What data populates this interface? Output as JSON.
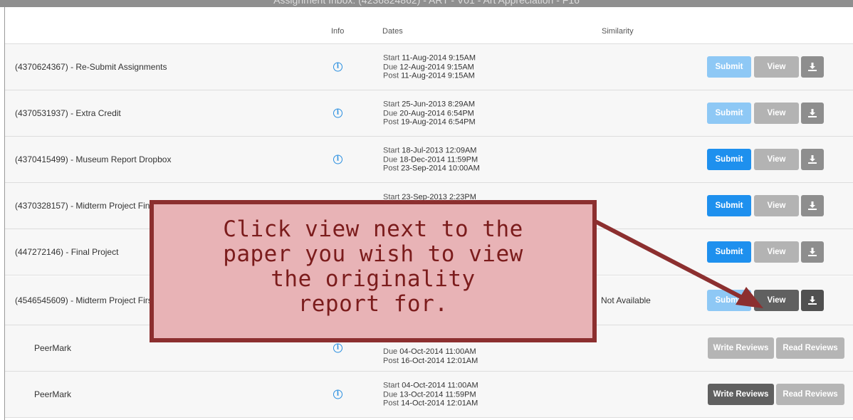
{
  "top_title": "Assignment Inbox: (4236824862) - ART - V01 - Art Appreciation - F16",
  "headers": {
    "info": "Info",
    "dates": "Dates",
    "similarity": "Similarity"
  },
  "labels": {
    "start": "Start",
    "due": "Due",
    "post": "Post",
    "submit": "Submit",
    "view": "View",
    "write_reviews": "Write Reviews",
    "read_reviews": "Read Reviews"
  },
  "assignments": [
    {
      "title": "(4370624367) - Re-Submit Assignments",
      "start": "11-Aug-2014  9:15AM",
      "due": "12-Aug-2014  9:15AM",
      "post": "11-Aug-2014  9:15AM",
      "similarity": ""
    },
    {
      "title": "(4370531937) - Extra Credit",
      "start": "25-Jun-2013  8:29AM",
      "due": "20-Aug-2014  6:54PM",
      "post": "19-Aug-2014  6:54PM",
      "similarity": ""
    },
    {
      "title": "(4370415499) - Museum Report Dropbox",
      "start": "18-Jul-2013  12:09AM",
      "due": "18-Dec-2014  11:59PM",
      "post": "23-Sep-2014  10:00AM",
      "similarity": ""
    },
    {
      "title": "(4370328157) - Midterm Project Fin",
      "start": "23-Sep-2013  2:23PM",
      "due": "",
      "post": "",
      "similarity": ""
    },
    {
      "title": "(447272146) - Final Project",
      "start": "",
      "due": "",
      "post": "",
      "similarity": ""
    },
    {
      "title": "(4546545609) - Midterm Project Firs",
      "start": "",
      "due": "",
      "post": "",
      "similarity": "Not Available"
    },
    {
      "title": "PeerMark",
      "start": "",
      "due": "04-Oct-2014  11:00AM",
      "post": "16-Oct-2014  12:01AM",
      "similarity": ""
    },
    {
      "title": "PeerMark",
      "start": "04-Oct-2014  11:00AM",
      "due": "13-Oct-2014  11:59PM",
      "post": "14-Oct-2014  12:01AM",
      "similarity": ""
    }
  ],
  "callout": {
    "line1": "Click view next to the",
    "line2": "paper you wish to view",
    "line3": "the originality",
    "line4": "report for."
  },
  "colors": {
    "submit_active": "#1e90ee",
    "submit_disabled": "#8ec8f5",
    "view_active": "#606060",
    "view_disabled": "#b3b3b3",
    "callout_fill": "#e8b3b6",
    "callout_border": "#8c2f2f"
  },
  "icons": {
    "info": "info-circle-icon",
    "download": "download-icon"
  }
}
